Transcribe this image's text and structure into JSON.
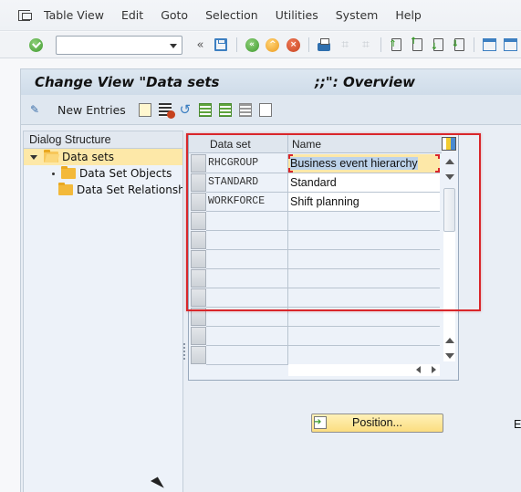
{
  "menubar": {
    "items": [
      {
        "label": "Table View",
        "mnemonic": "T"
      },
      {
        "label": "Edit",
        "mnemonic": "E"
      },
      {
        "label": "Goto",
        "mnemonic": "G"
      },
      {
        "label": "Selection",
        "mnemonic": "l"
      },
      {
        "label": "Utilities",
        "mnemonic": "s"
      },
      {
        "label": "System",
        "mnemonic": "y"
      },
      {
        "label": "Help",
        "mnemonic": "H"
      }
    ]
  },
  "toolbar": {
    "command_field": {
      "value": "",
      "placeholder": ""
    },
    "back_glyph": "«",
    "icons": [
      "enter-icon",
      "save-icon",
      "back-icon",
      "exit-icon",
      "cancel-icon",
      "print-icon",
      "find-icon",
      "find-next-icon",
      "first-page-icon",
      "previous-page-icon",
      "next-page-icon",
      "last-page-icon",
      "create-session-icon",
      "generate-shortcut-icon"
    ]
  },
  "title": "Change View \"Data sets                    ;;\": Overview",
  "app_toolbar": {
    "new_entries_label": "New Entries",
    "icons": [
      "display-change-icon",
      "copy-as-icon",
      "delete-icon",
      "undo-change-icon",
      "select-all-icon",
      "select-block-icon",
      "deselect-all-icon",
      "where-used-icon"
    ]
  },
  "dialog_structure": {
    "header": "Dialog Structure",
    "items": [
      {
        "label": "Data sets",
        "level": 0,
        "expanded": true,
        "selected": true
      },
      {
        "label": "Data Set Objects",
        "level": 1,
        "selected": false
      },
      {
        "label": "Data Set Relationships",
        "level": 1,
        "selected": false
      }
    ]
  },
  "table": {
    "columns": [
      "Data set",
      "Name"
    ],
    "rows": [
      {
        "key": "RHCGROUP",
        "name": "Business event hierarchy",
        "focused": true
      },
      {
        "key": "STANDARD",
        "name": "Standard",
        "focused": false
      },
      {
        "key": "WORKFORCE",
        "name": "Shift planning",
        "focused": false
      },
      {
        "key": "",
        "name": ""
      },
      {
        "key": "",
        "name": ""
      },
      {
        "key": "",
        "name": ""
      },
      {
        "key": "",
        "name": ""
      },
      {
        "key": "",
        "name": ""
      },
      {
        "key": "",
        "name": ""
      },
      {
        "key": "",
        "name": ""
      },
      {
        "key": "",
        "name": ""
      }
    ]
  },
  "position_button_label": "Position...",
  "entry_label_partial": "E",
  "colors": {
    "highlight_border": "#d9262a",
    "focus_cell": "#fde8a8",
    "button_yellow": "#fbdd7f"
  }
}
